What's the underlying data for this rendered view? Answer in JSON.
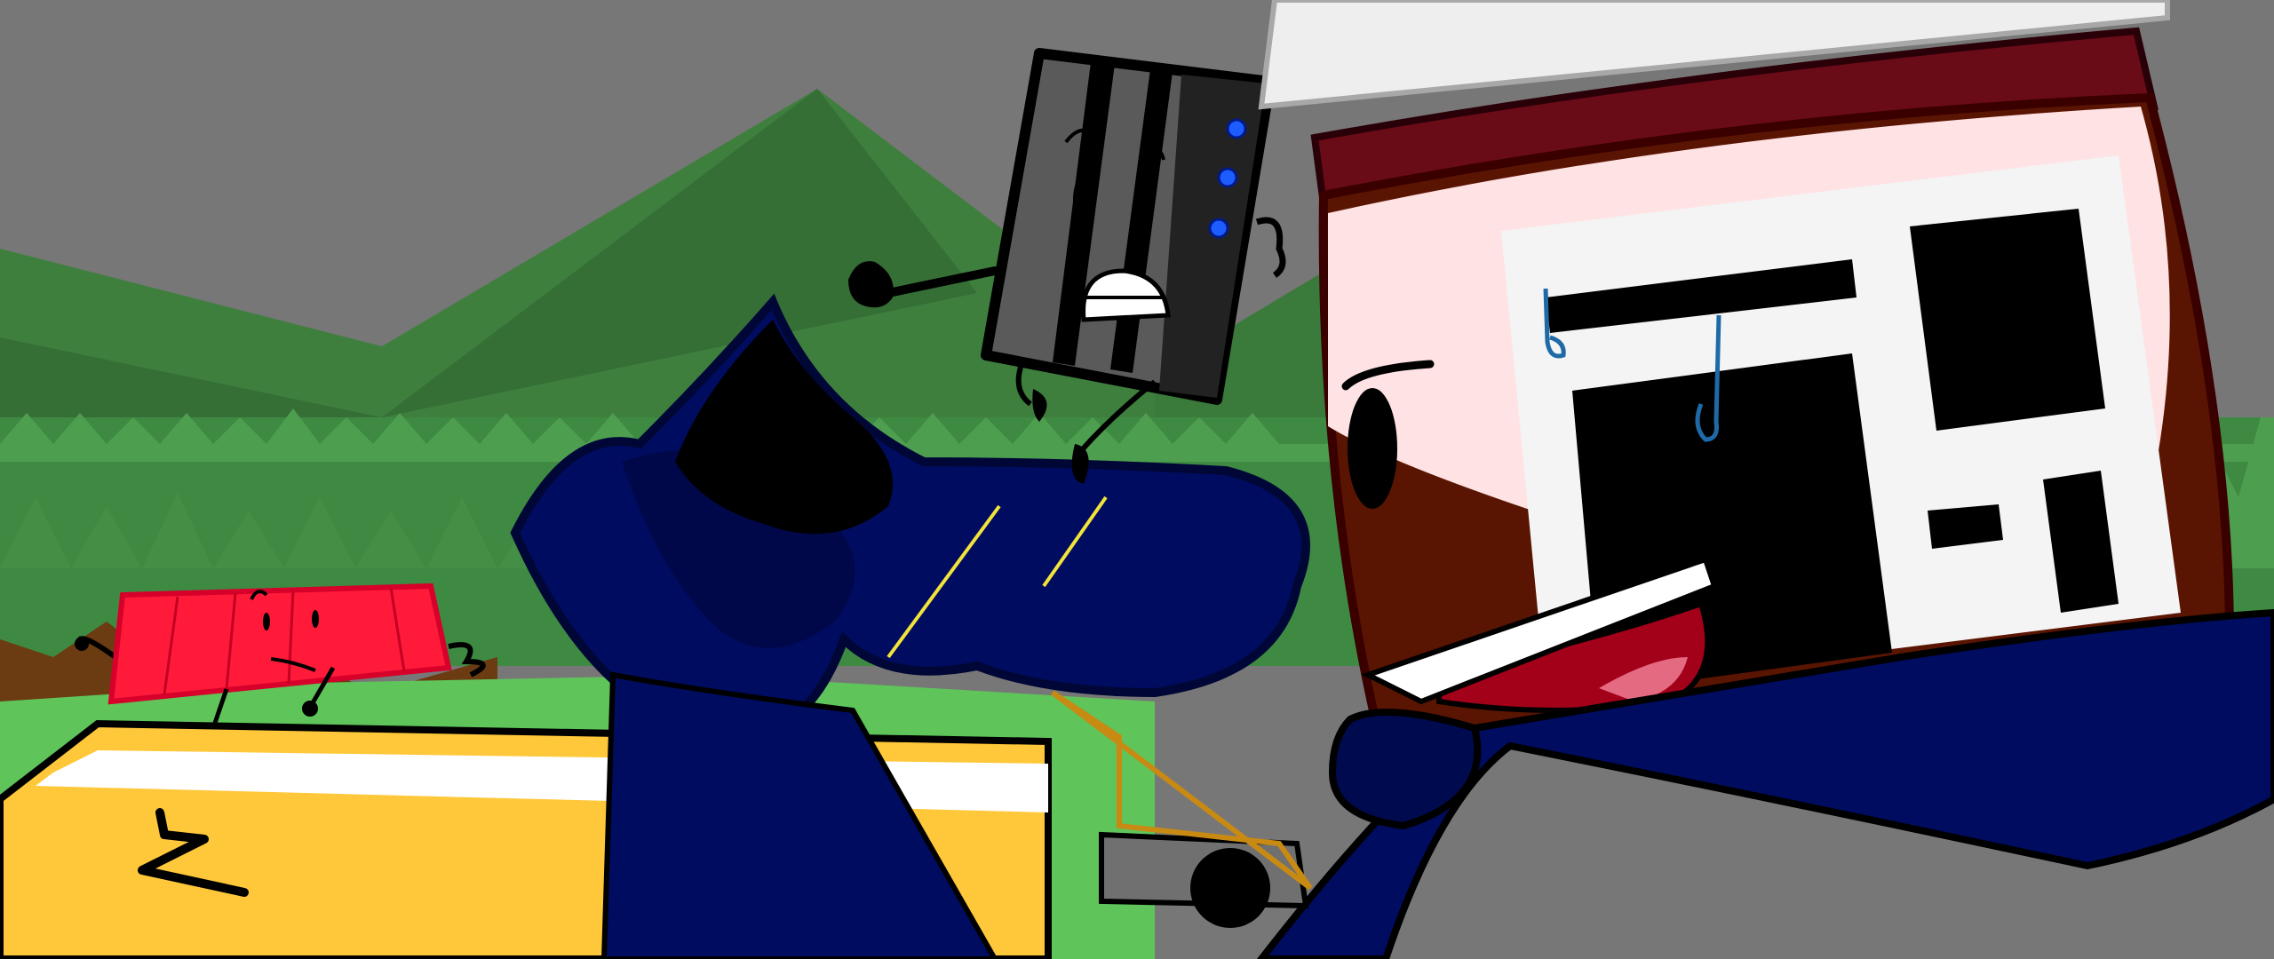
{
  "scene": {
    "kind": "animated cartoon still",
    "characters": [
      {
        "id": "gray-speaker",
        "role": "worried boxy device with blue indicator lights"
      },
      {
        "id": "red-bar",
        "role": "small red rectangular character on hill"
      },
      {
        "id": "maroon-box",
        "role": "large frightened maroon box with paper face"
      },
      {
        "id": "yellow-slab",
        "role": "yellow slab in foreground"
      },
      {
        "id": "navy-blob",
        "role": "dark navy shadowy shape"
      }
    ]
  },
  "colors": {
    "sky": "#777777",
    "mountain_far": "#3b7a3c",
    "mountain_near": "#2f6a33",
    "forest": "#3f8a43",
    "tree_light": "#4e9e50",
    "grass": "#5fc45a",
    "dirt": "#6b3b12",
    "navy": "#000c5f",
    "navy_dark": "#000736",
    "yellow": "#ffc83a",
    "maroon": "#6a0b18",
    "brown_face": "#5a1502",
    "paper": "#f4f4f4",
    "pink_face": "#ffe2e4",
    "red_bar": "#ff1a3a",
    "gray_speaker": "#5a5a5a",
    "blue_light": "#1d5cff",
    "sweat": "#1f6aa6",
    "outline": "#000000"
  }
}
